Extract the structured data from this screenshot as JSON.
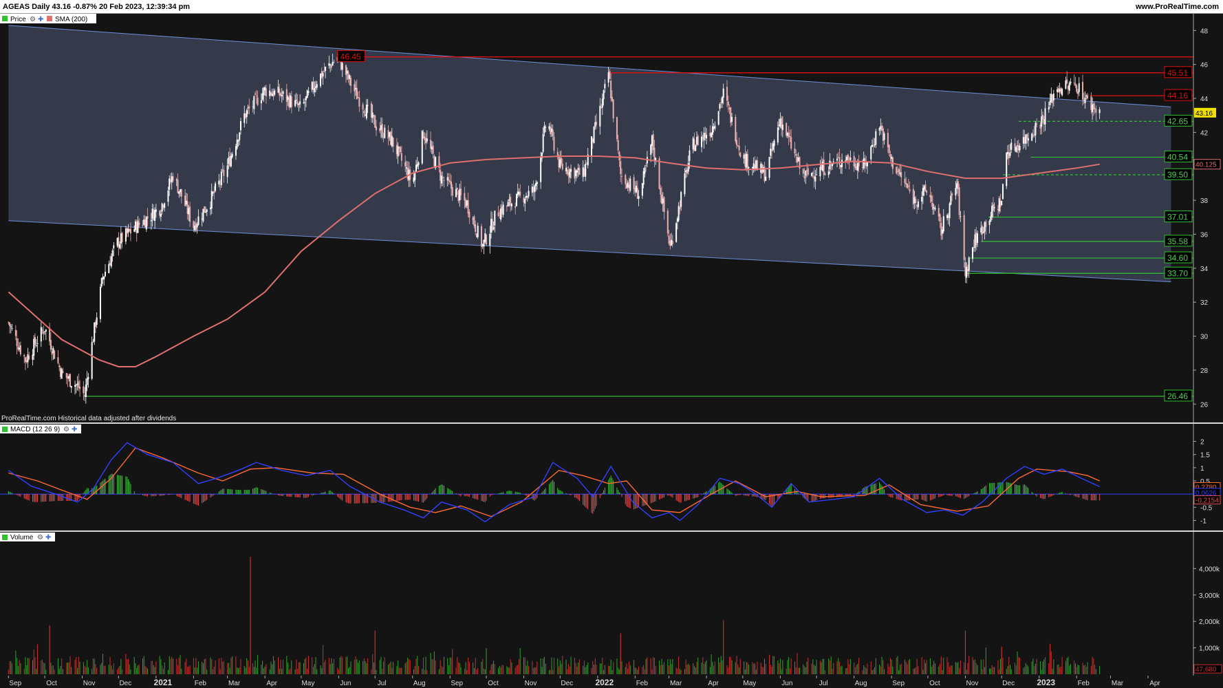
{
  "header": {
    "title": "AGEAS Daily 43.16 -0.87% 20 Feb 2023, 12:39:34 pm",
    "site": "www.ProRealTime.com"
  },
  "panels": {
    "price": {
      "legend_price": "Price",
      "legend_sma": "SMA (200)"
    },
    "footnote": "ProRealTime.com  Historical data adjusted after dividends",
    "macd": {
      "legend": "MACD (12 26 9)"
    },
    "volume": {
      "legend": "Volume"
    }
  },
  "colors": {
    "background": "#141414",
    "channel_fill": "#3a4154",
    "channel_line": "#6f8fd8",
    "sma": "#e07070",
    "resistance": "#e01010",
    "support": "#30c030",
    "candle_up": "#ffffff",
    "candle_down": "#e8b0b0",
    "macd_line": "#3040ff",
    "signal_line": "#ff6a30",
    "hist_pos": "#40c040",
    "hist_neg": "#e05050",
    "volume": "#c83030"
  },
  "chart_data": [
    {
      "type": "candlestick",
      "panel": "price",
      "series_names": [
        "Price",
        "SMA (200)"
      ],
      "ylim": [
        25,
        48.5
      ],
      "y_ticks": [
        26,
        28,
        30,
        32,
        34,
        36,
        38,
        40,
        42,
        44,
        46,
        48
      ],
      "x_ticks": [
        "Sep",
        "Oct",
        "Nov",
        "Dec",
        "2021",
        "Feb",
        "Mar",
        "Apr",
        "May",
        "Jun",
        "Jul",
        "Aug",
        "Sep",
        "Oct",
        "Nov",
        "Dec",
        "2022",
        "Feb",
        "Mar",
        "Apr",
        "May",
        "Jun",
        "Jul",
        "Aug",
        "Sep",
        "Oct",
        "Nov",
        "Dec",
        "2023",
        "Feb",
        "Mar",
        "Apr"
      ],
      "last_price": "43.16",
      "sma_last": "40.125",
      "price_path": [
        [
          "2020-09-01",
          30.8
        ],
        [
          "2020-09-15",
          28.6
        ],
        [
          "2020-10-01",
          30.5
        ],
        [
          "2020-10-15",
          27.8
        ],
        [
          "2020-10-29",
          27.0
        ],
        [
          "2020-11-03",
          26.5
        ],
        [
          "2020-11-09",
          29.5
        ],
        [
          "2020-11-18",
          33.5
        ],
        [
          "2020-11-30",
          35.5
        ],
        [
          "2020-12-15",
          36.4
        ],
        [
          "2021-01-05",
          37.6
        ],
        [
          "2021-01-15",
          39.5
        ],
        [
          "2021-02-01",
          36.5
        ],
        [
          "2021-02-15",
          38.0
        ],
        [
          "2021-03-01",
          40.0
        ],
        [
          "2021-03-15",
          43.0
        ],
        [
          "2021-04-01",
          44.5
        ],
        [
          "2021-04-15",
          44.2
        ],
        [
          "2021-05-01",
          43.4
        ],
        [
          "2021-05-15",
          45.2
        ],
        [
          "2021-05-31",
          46.45
        ],
        [
          "2021-06-15",
          44.3
        ],
        [
          "2021-07-01",
          42.5
        ],
        [
          "2021-07-15",
          41.5
        ],
        [
          "2021-08-01",
          39.0
        ],
        [
          "2021-08-10",
          42.0
        ],
        [
          "2021-08-25",
          39.3
        ],
        [
          "2021-09-15",
          37.8
        ],
        [
          "2021-09-28",
          35.3
        ],
        [
          "2021-10-10",
          37.3
        ],
        [
          "2021-10-25",
          38.0
        ],
        [
          "2021-11-10",
          38.6
        ],
        [
          "2021-11-20",
          42.8
        ],
        [
          "2021-12-01",
          40.0
        ],
        [
          "2021-12-20",
          39.5
        ],
        [
          "2022-01-05",
          43.8
        ],
        [
          "2022-01-10",
          45.51
        ],
        [
          "2022-01-20",
          39.5
        ],
        [
          "2022-02-05",
          38.3
        ],
        [
          "2022-02-15",
          41.5
        ],
        [
          "2022-03-02",
          35.2
        ],
        [
          "2022-03-20",
          41.2
        ],
        [
          "2022-04-05",
          42.2
        ],
        [
          "2022-04-15",
          44.3
        ],
        [
          "2022-05-01",
          40.5
        ],
        [
          "2022-05-20",
          39.5
        ],
        [
          "2022-06-01",
          42.8
        ],
        [
          "2022-06-20",
          39.4
        ],
        [
          "2022-07-10",
          40.0
        ],
        [
          "2022-07-25",
          40.5
        ],
        [
          "2022-08-10",
          40.0
        ],
        [
          "2022-08-22",
          42.5
        ],
        [
          "2022-09-01",
          40.3
        ],
        [
          "2022-09-20",
          38.0
        ],
        [
          "2022-10-01",
          38.6
        ],
        [
          "2022-10-12",
          36.2
        ],
        [
          "2022-10-25",
          39.0
        ],
        [
          "2022-11-01",
          33.7
        ],
        [
          "2022-11-08",
          35.5
        ],
        [
          "2022-11-20",
          37.0
        ],
        [
          "2022-12-01",
          38.0
        ],
        [
          "2022-12-05",
          40.8
        ],
        [
          "2022-12-20",
          41.6
        ],
        [
          "2023-01-05",
          42.9
        ],
        [
          "2023-01-15",
          44.6
        ],
        [
          "2023-02-01",
          44.8
        ],
        [
          "2023-02-10",
          43.8
        ],
        [
          "2023-02-20",
          43.16
        ]
      ],
      "sma_path": [
        [
          "2020-09-01",
          32.6
        ],
        [
          "2020-10-15",
          29.8
        ],
        [
          "2020-11-15",
          28.6
        ],
        [
          "2020-12-01",
          28.2
        ],
        [
          "2020-12-15",
          28.2
        ],
        [
          "2021-01-01",
          28.8
        ],
        [
          "2021-02-01",
          30.0
        ],
        [
          "2021-03-01",
          31.0
        ],
        [
          "2021-04-01",
          32.6
        ],
        [
          "2021-05-01",
          35.0
        ],
        [
          "2021-06-01",
          36.8
        ],
        [
          "2021-07-01",
          38.4
        ],
        [
          "2021-08-01",
          39.6
        ],
        [
          "2021-09-01",
          40.2
        ],
        [
          "2021-10-01",
          40.4
        ],
        [
          "2021-11-01",
          40.5
        ],
        [
          "2021-12-01",
          40.6
        ],
        [
          "2022-01-01",
          40.6
        ],
        [
          "2022-02-01",
          40.5
        ],
        [
          "2022-03-01",
          40.2
        ],
        [
          "2022-04-01",
          39.9
        ],
        [
          "2022-05-01",
          39.8
        ],
        [
          "2022-06-01",
          39.9
        ],
        [
          "2022-07-01",
          40.1
        ],
        [
          "2022-08-01",
          40.3
        ],
        [
          "2022-09-01",
          40.2
        ],
        [
          "2022-10-01",
          39.7
        ],
        [
          "2022-11-01",
          39.3
        ],
        [
          "2022-12-01",
          39.3
        ],
        [
          "2023-01-01",
          39.6
        ],
        [
          "2023-02-01",
          39.9
        ],
        [
          "2023-02-20",
          40.125
        ]
      ],
      "channel": {
        "upper": [
          [
            "2020-09-01",
            48.3
          ],
          [
            "2023-04-20",
            43.5
          ]
        ],
        "lower": [
          [
            "2020-09-01",
            36.8
          ],
          [
            "2023-04-20",
            33.2
          ]
        ]
      },
      "resistance_levels": [
        {
          "label": "46.45",
          "value": 46.45,
          "from": "2021-05-31",
          "to": "2021-06-22",
          "label_at": "left"
        },
        {
          "label": "46.45",
          "value": 46.45,
          "from": "2021-06-22",
          "to": "2023-04-20",
          "label_at": "none"
        },
        {
          "label": "45.51",
          "value": 45.51,
          "from": "2022-01-10",
          "to": "2023-04-20",
          "label_at": "right"
        },
        {
          "label": "44.16",
          "value": 44.16,
          "from": "2023-02-12",
          "to": "2023-04-20",
          "label_at": "right"
        }
      ],
      "support_levels": [
        {
          "label": "42.65",
          "value": 42.65,
          "from": "2022-12-15",
          "dashed": true
        },
        {
          "label": "40.54",
          "value": 40.54,
          "from": "2022-12-25",
          "dashed": false
        },
        {
          "label": "39.50",
          "value": 39.5,
          "from": "2022-12-02",
          "dashed": true
        },
        {
          "label": "37.01",
          "value": 37.01,
          "from": "2022-11-20",
          "dashed": false
        },
        {
          "label": "35.58",
          "value": 35.58,
          "from": "2022-11-14",
          "dashed": false
        },
        {
          "label": "34.60",
          "value": 34.6,
          "from": "2022-11-04",
          "dashed": false
        },
        {
          "label": "33.70",
          "value": 33.7,
          "from": "2022-11-01",
          "dashed": false
        },
        {
          "label": "26.46",
          "value": 26.46,
          "from": "2020-11-03",
          "dashed": false
        }
      ]
    },
    {
      "type": "line",
      "panel": "macd",
      "series_names": [
        "MACD",
        "Signal",
        "Histogram"
      ],
      "ylim": [
        -1.3,
        2.3
      ],
      "y_ticks": [
        "2",
        "1.5",
        "1",
        "0.5",
        "0",
        "-0.5",
        "-1"
      ],
      "value_labels": [
        "0.2780",
        "0.0626",
        "-0.2154"
      ],
      "macd_path": [
        [
          "2020-09-01",
          0.9
        ],
        [
          "2020-09-20",
          0.3
        ],
        [
          "2020-10-10",
          0.0
        ],
        [
          "2020-10-28",
          -0.3
        ],
        [
          "2020-11-10",
          0.2
        ],
        [
          "2020-11-25",
          1.3
        ],
        [
          "2020-12-08",
          1.95
        ],
        [
          "2020-12-25",
          1.5
        ],
        [
          "2021-01-15",
          1.2
        ],
        [
          "2021-02-05",
          0.4
        ],
        [
          "2021-02-20",
          0.6
        ],
        [
          "2021-03-10",
          0.9
        ],
        [
          "2021-03-25",
          1.2
        ],
        [
          "2021-04-15",
          0.9
        ],
        [
          "2021-05-05",
          0.7
        ],
        [
          "2021-05-25",
          0.9
        ],
        [
          "2021-06-10",
          0.3
        ],
        [
          "2021-07-05",
          -0.3
        ],
        [
          "2021-07-25",
          -0.6
        ],
        [
          "2021-08-10",
          -0.9
        ],
        [
          "2021-08-25",
          -0.3
        ],
        [
          "2021-09-15",
          -0.6
        ],
        [
          "2021-09-30",
          -1.05
        ],
        [
          "2021-10-20",
          -0.4
        ],
        [
          "2021-11-10",
          -0.1
        ],
        [
          "2021-11-25",
          1.2
        ],
        [
          "2021-12-15",
          0.6
        ],
        [
          "2021-12-28",
          -0.1
        ],
        [
          "2022-01-12",
          1.05
        ],
        [
          "2022-01-30",
          -0.3
        ],
        [
          "2022-02-15",
          -0.9
        ],
        [
          "2022-03-01",
          -0.7
        ],
        [
          "2022-03-10",
          -1.0
        ],
        [
          "2022-03-25",
          -0.4
        ],
        [
          "2022-04-12",
          0.6
        ],
        [
          "2022-04-28",
          0.4
        ],
        [
          "2022-05-12",
          0.0
        ],
        [
          "2022-05-25",
          -0.5
        ],
        [
          "2022-06-10",
          0.4
        ],
        [
          "2022-06-25",
          -0.3
        ],
        [
          "2022-07-15",
          -0.2
        ],
        [
          "2022-08-01",
          -0.1
        ],
        [
          "2022-08-22",
          0.6
        ],
        [
          "2022-09-10",
          -0.2
        ],
        [
          "2022-09-30",
          -0.7
        ],
        [
          "2022-10-15",
          -0.6
        ],
        [
          "2022-10-30",
          -0.8
        ],
        [
          "2022-11-15",
          -0.3
        ],
        [
          "2022-12-05",
          0.6
        ],
        [
          "2022-12-20",
          1.05
        ],
        [
          "2023-01-05",
          0.75
        ],
        [
          "2023-01-20",
          0.95
        ],
        [
          "2023-02-05",
          0.6
        ],
        [
          "2023-02-20",
          0.28
        ]
      ],
      "signal_path": [
        [
          "2020-09-01",
          0.8
        ],
        [
          "2020-09-25",
          0.5
        ],
        [
          "2020-10-15",
          0.15
        ],
        [
          "2020-11-05",
          -0.2
        ],
        [
          "2020-11-25",
          0.6
        ],
        [
          "2020-12-15",
          1.75
        ],
        [
          "2021-01-05",
          1.4
        ],
        [
          "2021-02-05",
          0.8
        ],
        [
          "2021-02-25",
          0.5
        ],
        [
          "2021-03-20",
          0.95
        ],
        [
          "2021-04-10",
          1.0
        ],
        [
          "2021-05-10",
          0.8
        ],
        [
          "2021-06-05",
          0.75
        ],
        [
          "2021-07-05",
          0.0
        ],
        [
          "2021-07-30",
          -0.5
        ],
        [
          "2021-08-20",
          -0.7
        ],
        [
          "2021-09-10",
          -0.45
        ],
        [
          "2021-10-05",
          -0.85
        ],
        [
          "2021-10-30",
          -0.3
        ],
        [
          "2021-11-30",
          0.9
        ],
        [
          "2021-12-20",
          0.7
        ],
        [
          "2022-01-10",
          0.4
        ],
        [
          "2022-01-25",
          0.5
        ],
        [
          "2022-02-15",
          -0.6
        ],
        [
          "2022-03-10",
          -0.7
        ],
        [
          "2022-04-05",
          0.0
        ],
        [
          "2022-04-25",
          0.5
        ],
        [
          "2022-05-20",
          -0.1
        ],
        [
          "2022-06-15",
          0.1
        ],
        [
          "2022-07-05",
          -0.1
        ],
        [
          "2022-08-10",
          -0.05
        ],
        [
          "2022-08-30",
          0.35
        ],
        [
          "2022-09-25",
          -0.4
        ],
        [
          "2022-10-25",
          -0.65
        ],
        [
          "2022-11-20",
          -0.45
        ],
        [
          "2022-12-15",
          0.6
        ],
        [
          "2022-12-30",
          0.95
        ],
        [
          "2023-01-25",
          0.85
        ],
        [
          "2023-02-10",
          0.7
        ],
        [
          "2023-02-20",
          0.5
        ]
      ]
    },
    {
      "type": "bar",
      "panel": "volume",
      "series_names": [
        "Volume"
      ],
      "ylim": [
        0,
        5000
      ],
      "y_ticks": [
        "4,000k",
        "3,000k",
        "2,000k",
        "1,000k"
      ],
      "value_label": "47,680",
      "spikes": [
        [
          "2020-10-05",
          1850
        ],
        [
          "2021-03-20",
          4450
        ],
        [
          "2021-07-01",
          1650
        ],
        [
          "2022-01-20",
          1550
        ],
        [
          "2022-04-15",
          2050
        ],
        [
          "2022-11-01",
          1650
        ],
        [
          "2022-12-01",
          1050
        ],
        [
          "2023-01-10",
          1150
        ]
      ]
    }
  ]
}
